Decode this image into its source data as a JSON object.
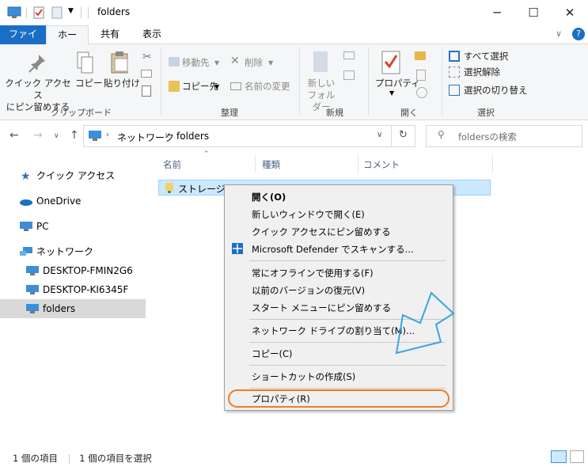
{
  "window": {
    "title": "folders",
    "min": "─",
    "max": "☐",
    "close": "✕"
  },
  "tabs": {
    "file": "ファイル",
    "home": "ホーム",
    "share": "共有",
    "view": "表示",
    "help": "?"
  },
  "ribbon": {
    "pin_quick_access": "クイック アクセス\nにピン留めする",
    "copy": "コピー",
    "paste": "貼り付け",
    "group_clipboard": "クリップボード",
    "move_to": "移動先",
    "copy_to": "コピー先",
    "delete": "削除",
    "rename": "名前の変更",
    "group_organize": "整理",
    "new_folder": "新しい\nフォルダー",
    "group_new": "新規",
    "properties": "プロパティ",
    "group_open": "開く",
    "select_all": "すべて選択",
    "select_none": "選択解除",
    "invert_selection": "選択の切り替え",
    "group_select": "選択"
  },
  "address": {
    "network": "ネットワーク",
    "folder": "folders",
    "search_placeholder": "foldersの検索"
  },
  "sidebar": {
    "items": [
      {
        "label": "クイック アクセス"
      },
      {
        "label": "OneDrive"
      },
      {
        "label": "PC"
      },
      {
        "label": "ネットワーク"
      },
      {
        "label": "DESKTOP-FMIN2G6"
      },
      {
        "label": "DESKTOP-KI6345F"
      },
      {
        "label": "folders"
      }
    ]
  },
  "columns": {
    "name": "名前",
    "type": "種類",
    "comment": "コメント"
  },
  "files": [
    {
      "name": "ストレージ１"
    }
  ],
  "context_menu": {
    "items": [
      "開く(O)",
      "新しいウィンドウで開く(E)",
      "クイック アクセスにピン留めする",
      "Microsoft Defender でスキャンする...",
      "常にオフラインで使用する(F)",
      "以前のバージョンの復元(V)",
      "スタート メニューにピン留めする",
      "ネットワーク ドライブの割り当て(M)...",
      "コピー(C)",
      "ショートカットの作成(S)",
      "プロパティ(R)"
    ]
  },
  "status": {
    "count": "1 個の項目",
    "selected": "1 個の項目を選択"
  },
  "colors": {
    "accent": "#1a6fc4",
    "highlight": "#f07c24",
    "arrow": "#3aa3e3"
  }
}
